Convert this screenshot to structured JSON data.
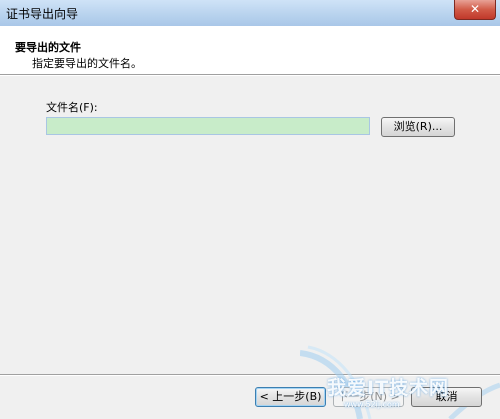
{
  "window": {
    "title": "证书导出向导",
    "close_label": "✕"
  },
  "header": {
    "title": "要导出的文件",
    "subtitle": "指定要导出的文件名。"
  },
  "form": {
    "file_name_label": "文件名(F):",
    "file_name_value": "",
    "browse_label": "浏览(R)..."
  },
  "footer": {
    "back_label": "< 上一步(B)",
    "next_label": "下一步(N) >",
    "cancel_label": "取消"
  },
  "watermark": {
    "text": "我爱IT技术网",
    "url": "www.52ij.com"
  }
}
